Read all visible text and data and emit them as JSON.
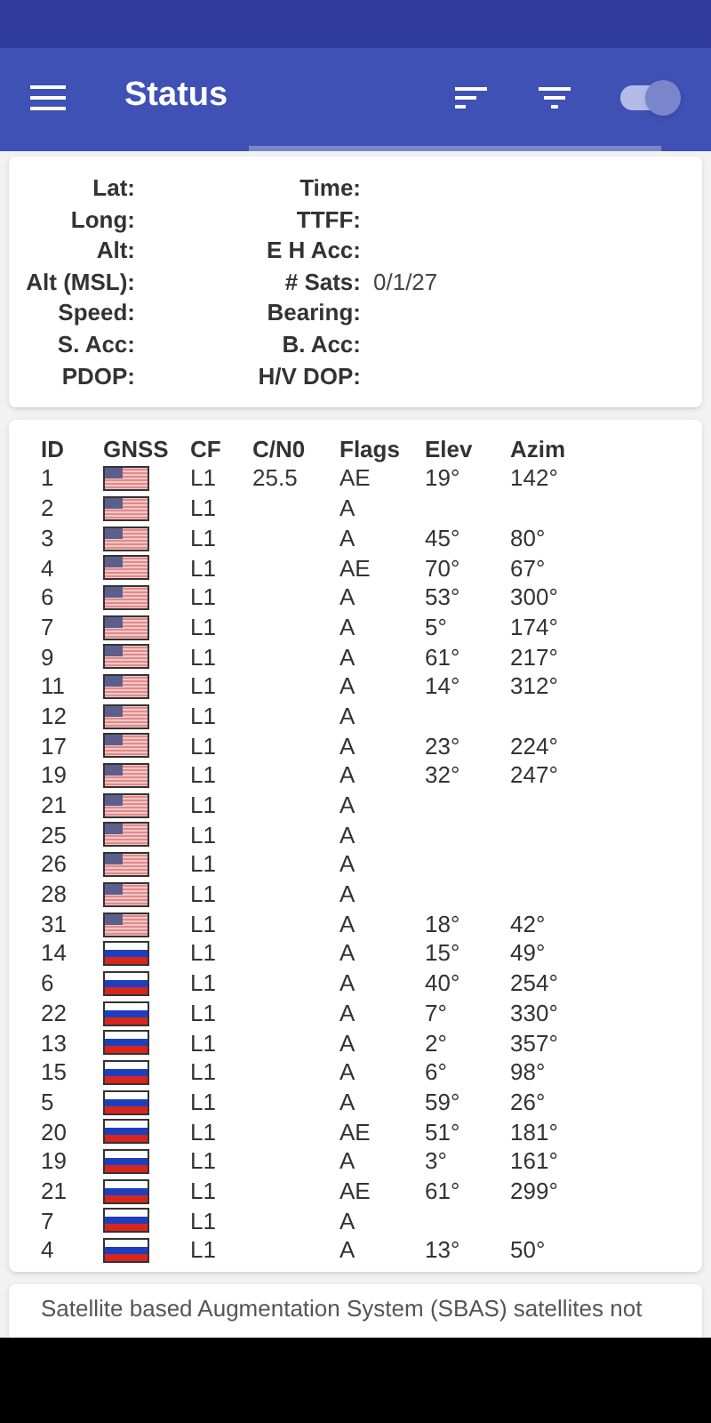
{
  "app_bar": {
    "title": "Status",
    "toggle_on": true
  },
  "fix_info": [
    {
      "label": "Lat:"
    },
    {
      "label": "Long:"
    },
    {
      "label": "Alt:"
    },
    {
      "label": "Alt (MSL):"
    },
    {
      "label": "Speed:"
    },
    {
      "label": "S. Acc:"
    },
    {
      "label": "PDOP:"
    }
  ],
  "fix_info_2": [
    {
      "label": "Time:"
    },
    {
      "label": "TTFF:"
    },
    {
      "label": "E H Acc:"
    },
    {
      "label": "# Sats:",
      "value": "0/1/27"
    },
    {
      "label": "Bearing:"
    },
    {
      "label": "B. Acc:"
    },
    {
      "label": "H/V DOP:"
    }
  ],
  "table": {
    "columns": [
      "ID",
      "GNSS",
      "CF",
      "C/N0",
      "Flags",
      "Elev",
      "Azim"
    ],
    "rows": [
      {
        "id": "1",
        "kind": "usa",
        "cf": "L1",
        "cn0": "25.5",
        "flags": "AE",
        "elev": "19°",
        "azim": "142°"
      },
      {
        "id": "2",
        "kind": "usa",
        "cf": "L1",
        "flags": "A"
      },
      {
        "id": "3",
        "kind": "usa",
        "cf": "L1",
        "flags": "A",
        "elev": "45°",
        "azim": "80°"
      },
      {
        "id": "4",
        "kind": "usa",
        "cf": "L1",
        "flags": "AE",
        "elev": "70°",
        "azim": "67°"
      },
      {
        "id": "6",
        "kind": "usa",
        "cf": "L1",
        "flags": "A",
        "elev": "53°",
        "azim": "300°"
      },
      {
        "id": "7",
        "kind": "usa",
        "cf": "L1",
        "flags": "A",
        "elev": "5°",
        "azim": "174°"
      },
      {
        "id": "9",
        "kind": "usa",
        "cf": "L1",
        "flags": "A",
        "elev": "61°",
        "azim": "217°"
      },
      {
        "id": "11",
        "kind": "usa",
        "cf": "L1",
        "flags": "A",
        "elev": "14°",
        "azim": "312°"
      },
      {
        "id": "12",
        "kind": "usa",
        "cf": "L1",
        "flags": "A"
      },
      {
        "id": "17",
        "kind": "usa",
        "cf": "L1",
        "flags": "A",
        "elev": "23°",
        "azim": "224°"
      },
      {
        "id": "19",
        "kind": "usa",
        "cf": "L1",
        "flags": "A",
        "elev": "32°",
        "azim": "247°"
      },
      {
        "id": "21",
        "kind": "usa",
        "cf": "L1",
        "flags": "A"
      },
      {
        "id": "25",
        "kind": "usa",
        "cf": "L1",
        "flags": "A"
      },
      {
        "id": "26",
        "kind": "usa",
        "cf": "L1",
        "flags": "A"
      },
      {
        "id": "28",
        "kind": "usa",
        "cf": "L1",
        "flags": "A"
      },
      {
        "id": "31",
        "kind": "usa",
        "cf": "L1",
        "flags": "A",
        "elev": "18°",
        "azim": "42°"
      },
      {
        "id": "14",
        "kind": "russia",
        "cf": "L1",
        "flags": "A",
        "elev": "15°",
        "azim": "49°"
      },
      {
        "id": "6",
        "kind": "russia",
        "cf": "L1",
        "flags": "A",
        "elev": "40°",
        "azim": "254°"
      },
      {
        "id": "22",
        "kind": "russia",
        "cf": "L1",
        "flags": "A",
        "elev": "7°",
        "azim": "330°"
      },
      {
        "id": "13",
        "kind": "russia",
        "cf": "L1",
        "flags": "A",
        "elev": "2°",
        "azim": "357°"
      },
      {
        "id": "15",
        "kind": "russia",
        "cf": "L1",
        "flags": "A",
        "elev": "6°",
        "azim": "98°"
      },
      {
        "id": "5",
        "kind": "russia",
        "cf": "L1",
        "flags": "A",
        "elev": "59°",
        "azim": "26°"
      },
      {
        "id": "20",
        "kind": "russia",
        "cf": "L1",
        "flags": "AE",
        "elev": "51°",
        "azim": "181°"
      },
      {
        "id": "19",
        "kind": "russia",
        "cf": "L1",
        "flags": "A",
        "elev": "3°",
        "azim": "161°"
      },
      {
        "id": "21",
        "kind": "russia",
        "cf": "L1",
        "flags": "AE",
        "elev": "61°",
        "azim": "299°"
      },
      {
        "id": "7",
        "kind": "russia",
        "cf": "L1",
        "flags": "A"
      },
      {
        "id": "4",
        "kind": "russia",
        "cf": "L1",
        "flags": "A",
        "elev": "13°",
        "azim": "50°"
      }
    ]
  },
  "sbas_note": "Satellite based Augmentation System (SBAS) satellites not"
}
